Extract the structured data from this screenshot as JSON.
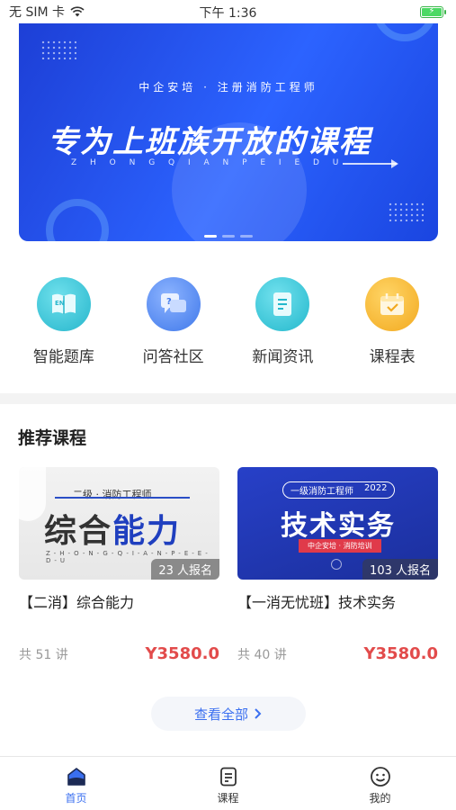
{
  "status_bar": {
    "carrier": "无 SIM 卡",
    "time": "下午 1:36",
    "battery_level": 1.0
  },
  "banner": {
    "subtitle": "中企安培 · 注册消防工程师",
    "title": "专为上班族开放的课程",
    "pinyin": "Z H O N G Q I A N P E I E D U"
  },
  "quick_nav": [
    {
      "label": "智能题库",
      "icon": "book-icon",
      "color": "#33c3d6"
    },
    {
      "label": "问答社区",
      "icon": "chat-bubble-icon",
      "color": "#4a86f0"
    },
    {
      "label": "新闻资讯",
      "icon": "document-icon",
      "color": "#2fc0d4"
    },
    {
      "label": "课程表",
      "icon": "calendar-icon",
      "color": "#f5b52e"
    }
  ],
  "recommended": {
    "title": "推荐课程",
    "courses": [
      {
        "thumb_sub": "二级 · 消防工程师",
        "thumb_main_a": "综合",
        "thumb_main_b": "能力",
        "thumb_pinyin": "Z-H-O-N-G-Q-I-A-N-P-E-E-D-U",
        "enroll": "23 人报名",
        "title": "【二消】综合能力",
        "lessons": "共 51 讲",
        "price": "Y3580.0"
      },
      {
        "thumb_badge_a": "一级消防工程师",
        "thumb_badge_b": "2022",
        "thumb_main": "技术实务",
        "thumb_tag": "中企安培 · 消防培训",
        "enroll": "103 人报名",
        "title": "【一消无忧班】技术实务",
        "lessons": "共 40 讲",
        "price": "Y3580.0"
      }
    ]
  },
  "view_all": "查看全部",
  "tabs": [
    {
      "label": "首页",
      "icon": "home-icon",
      "active": true
    },
    {
      "label": "课程",
      "icon": "course-list-icon",
      "active": false
    },
    {
      "label": "我的",
      "icon": "smiley-face-icon",
      "active": false
    }
  ],
  "colors": {
    "accent": "#3a6ff0",
    "price": "#e24b4b",
    "battery": "#4cd964"
  }
}
